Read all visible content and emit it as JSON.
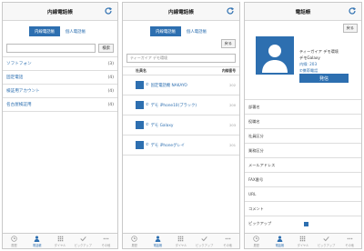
{
  "screen1": {
    "title": "内線電話帳",
    "seg_internal": "内線電話帳",
    "seg_personal": "個人電話帳",
    "search_button": "検索",
    "groups": [
      {
        "label": "ソフトフォン",
        "count": "(3)"
      },
      {
        "label": "固定電話",
        "count": "(4)"
      },
      {
        "label": "検証用アカウント",
        "count": "(4)"
      },
      {
        "label": "名古屋検証用",
        "count": "(4)"
      }
    ]
  },
  "screen2": {
    "title": "内線電話帳",
    "seg_internal": "内線電話帳",
    "seg_personal": "個人電話帳",
    "back_button": "戻る",
    "search_placeholder": "ティーガイア デモ環境",
    "col_name": "社員名",
    "col_number": "内線番号",
    "contacts": [
      {
        "name": "固定電話機 NAKAYO",
        "number": "202"
      },
      {
        "name": "デモ iPhone10(ブラック)",
        "number": "200"
      },
      {
        "name": "デモ Galaxy",
        "number": "203"
      },
      {
        "name": "デモ iPhoneグレイ",
        "number": "201"
      }
    ]
  },
  "screen3": {
    "title": "電話帳",
    "back_button": "戻る",
    "org": "ティーガイア デモ環境",
    "name": "デモGalaxy",
    "extension": "内線: 203",
    "phone_label": "携帯電話",
    "call_button": "発信",
    "fields": [
      "部署名",
      "役職名",
      "社員区分",
      "業務区分",
      "メールアドレス",
      "FAX番号",
      "URL",
      "コメント",
      "ピックアップ"
    ]
  },
  "tabbar": [
    "履歴",
    "電話帳",
    "ダイヤル",
    "ピックアップ",
    "その他"
  ],
  "colors": {
    "accent": "#2d6fb0"
  }
}
